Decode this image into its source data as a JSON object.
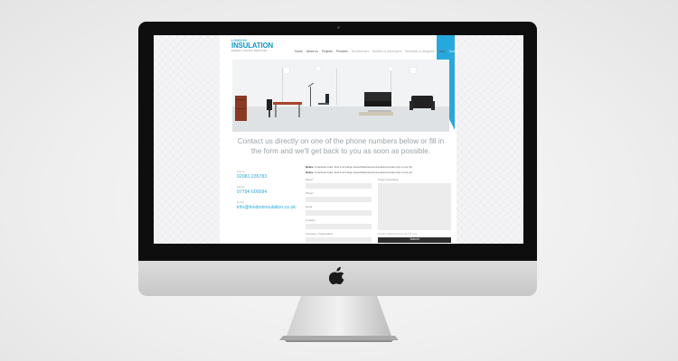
{
  "logo": {
    "line1": "LONDON",
    "line2": "INSULATION",
    "line3": "ENERGY SAVING SERVICES"
  },
  "nav": [
    {
      "label": "Home",
      "state": "normal"
    },
    {
      "label": "About us",
      "state": "normal"
    },
    {
      "label": "Projects",
      "state": "normal"
    },
    {
      "label": "Products",
      "state": "normal"
    },
    {
      "label": "Homeowners",
      "state": "dim"
    },
    {
      "label": "Builders & developers",
      "state": "dim"
    },
    {
      "label": "Architects & designers",
      "state": "dim"
    },
    {
      "label": "Links",
      "state": "normal"
    },
    {
      "label": "Contact us",
      "state": "active"
    }
  ],
  "headline": "Contact us directly on one of the phone numbers below or fill in the form and we'll get back to you as soon as possible.",
  "contact": {
    "phone_label": "Phone",
    "phone": "02081 235783",
    "mobile_label": "Mobile",
    "mobile": "07794 600094",
    "email_label": "Email",
    "email": "info@londoninsulation.co.uk"
  },
  "notices": [
    {
      "title": "Notice",
      "text": ": Undefined index: tbsd in E:\\Indigo Hosted\\Sites\\londoninsulation\\contact.php on line 36"
    },
    {
      "title": "Notice",
      "text": ": Undefined index: tbsd in E:\\Indigo Hosted\\Sites\\londoninsulation\\contact.php on line 40"
    }
  ],
  "form": {
    "name_label": "Name*",
    "phone_label": "Phone*",
    "email_label": "Email",
    "location_label": "Location",
    "company_label": "Company / Organisation",
    "description_label": "Project description",
    "privacy_note": "Privacy statement and opt-out note",
    "submit_label": "Submit"
  }
}
